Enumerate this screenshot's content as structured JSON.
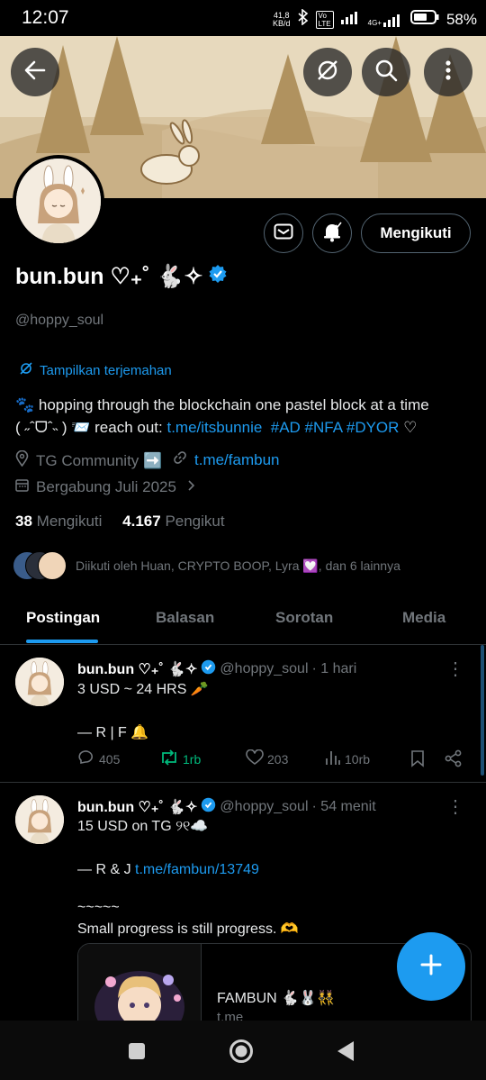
{
  "status_bar": {
    "time": "12:07",
    "net_speed": "41,8\nKB/d",
    "battery": "58%",
    "icons": [
      "bluetooth-icon",
      "volte-icon",
      "signal-icon",
      "4g-signal-icon",
      "battery-icon"
    ]
  },
  "header": {
    "icons": [
      "back-arrow-icon",
      "no-translate-icon",
      "search-icon",
      "more-vertical-icon"
    ]
  },
  "profile": {
    "display_name": "bun.bun ♡₊˚ 🐇✧",
    "handle": "@hoppy_soul",
    "translate_label": "Tampilkan terjemahan",
    "bio_line1": "🐾 hopping through the blockchain one pastel block at a time",
    "bio_line2_prefix": "( ˶ˆᗜˆ˵ ) 📨 reach out: ",
    "bio_link": "t.me/itsbunnie",
    "bio_tags": "#AD #NFA #DYOR",
    "bio_suffix": " ♡",
    "location": "TG Community ➡️",
    "website": "t.me/fambun",
    "joined": "Bergabung Juli 2025",
    "following_count": "38",
    "following_label": "Mengikuti",
    "followers_count": "4.167",
    "followers_label": "Pengikut",
    "followed_by": "Diikuti oleh Huan, CRYPTO BOOP, Lyra 💟, dan 6 lainnya",
    "follow_button": "Mengikuti"
  },
  "tabs": [
    "Postingan",
    "Balasan",
    "Sorotan",
    "Media"
  ],
  "accent_color": "#1d9bf0",
  "posts": [
    {
      "name": "bun.bun ♡₊˚ 🐇✧",
      "handle": "@hoppy_soul",
      "time": "· 1 hari",
      "text": "3 USD ~ 24 HRS 🥕\n\n— R | F 🔔",
      "replies": "405",
      "reposts": "1rb",
      "likes": "203",
      "views": "10rb"
    },
    {
      "name": "bun.bun ♡₊˚ 🐇✧",
      "handle": "@hoppy_soul",
      "time": "· 54 menit",
      "text_line1": "15 USD on TG ୨୧☁️",
      "text_line2_prefix": "— R & J ",
      "text_line2_link": "t.me/fambun/13749",
      "text_line3": "~~~~~",
      "text_line4": "Small progress is still progress. 🫶",
      "card_title": "FAMBUN 🐇🐰👯",
      "card_domain": "t.me"
    }
  ]
}
